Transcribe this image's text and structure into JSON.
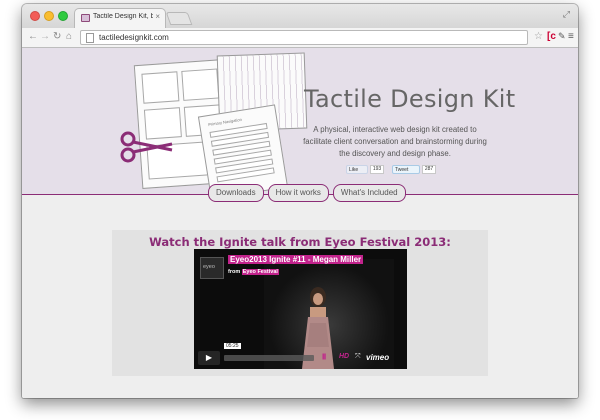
{
  "browser": {
    "tab_title": "Tactile Design Kit, by Meg",
    "tab_close": "×",
    "url": "tactiledesignkit.com"
  },
  "hero": {
    "title": "Tactile Design Kit",
    "tagline": "A physical, interactive web design kit created to facilitate client conversation and brainstorming during the discovery and design phase.",
    "sheet_heading": "Primary Navigation",
    "like_label": "Like",
    "like_count": "193",
    "tweet_label": "Tweet",
    "tweet_count": "287"
  },
  "nav": {
    "items": [
      "Downloads",
      "How it works",
      "What's Included"
    ]
  },
  "video": {
    "heading": "Watch the Ignite talk from Eyeo Festival 2013:",
    "logo": "eyeo",
    "title": "Eyeo2013 Ignite #11 - Megan Miller",
    "source_prefix": "from",
    "source_name": "Eyeo Festival",
    "timecode": "05:25",
    "hd": "HD",
    "brand": "vimeo"
  },
  "colors": {
    "accent": "#8b2c76",
    "hero_bg": "#e5dfe9",
    "page_bg": "#eeeeee",
    "vimeo_pink": "#c2238c"
  }
}
